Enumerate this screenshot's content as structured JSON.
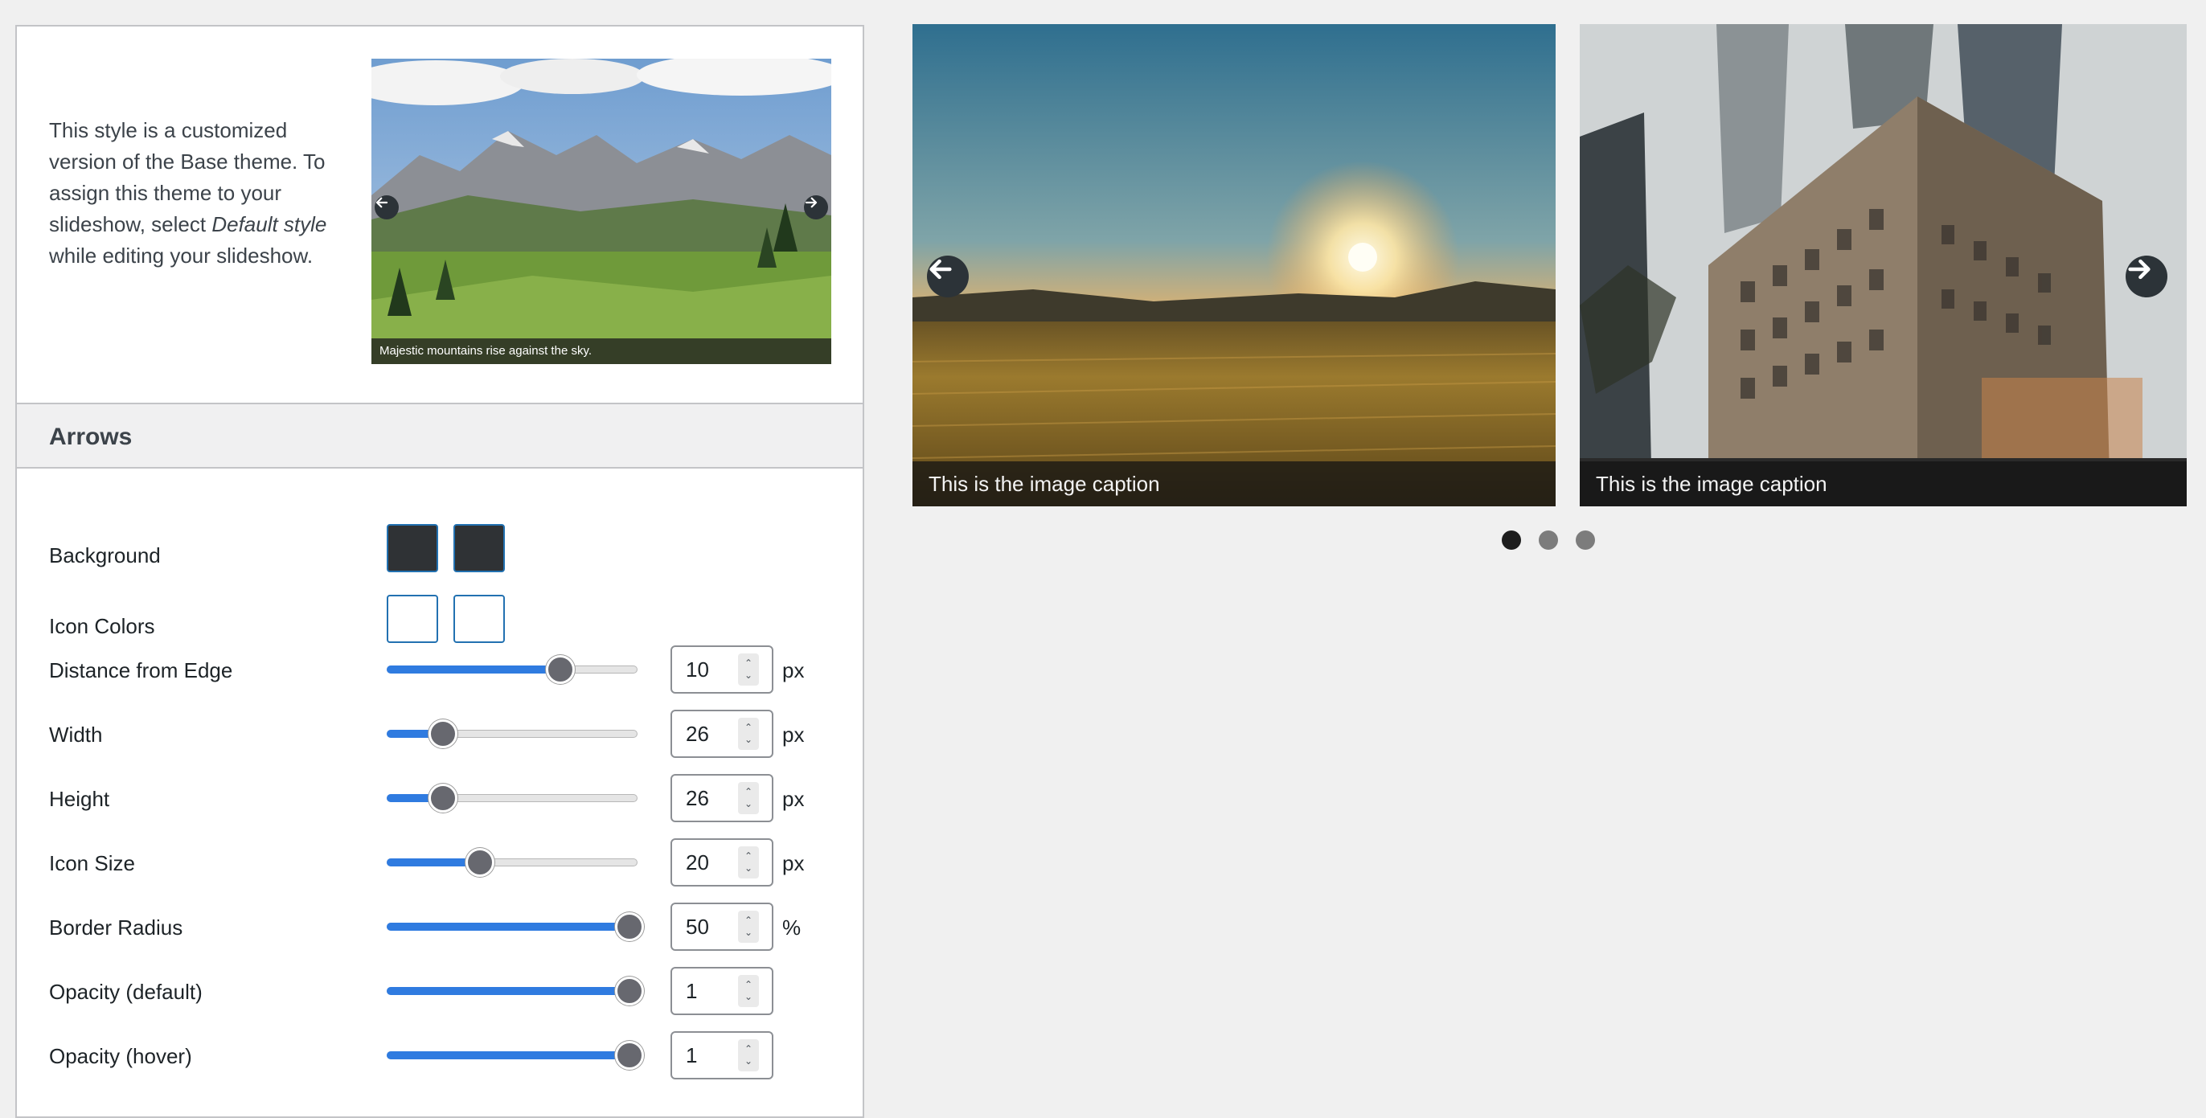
{
  "intro": {
    "text_before": "This style is a customized version of the Base theme. To assign this theme to your slideshow, select ",
    "text_em": "Default style",
    "text_after": " while editing your slideshow.",
    "preview_caption": "Majestic mountains rise against the sky."
  },
  "arrows_section": {
    "title": "Arrows",
    "background": {
      "label": "Background",
      "colors": [
        "#2f3235",
        "#2f3235"
      ]
    },
    "icon_colors": {
      "label": "Icon Colors",
      "colors": [
        "#ffffff",
        "#ffffff"
      ]
    },
    "settings": [
      {
        "label": "Distance from Edge",
        "value": "10",
        "unit": "px",
        "slider_fraction": 0.7
      },
      {
        "label": "Width",
        "value": "26",
        "unit": "px",
        "slider_fraction": 0.19
      },
      {
        "label": "Height",
        "value": "26",
        "unit": "px",
        "slider_fraction": 0.19
      },
      {
        "label": "Icon Size",
        "value": "20",
        "unit": "px",
        "slider_fraction": 0.35
      },
      {
        "label": "Border Radius",
        "value": "50",
        "unit": "%",
        "slider_fraction": 1.0
      },
      {
        "label": "Opacity (default)",
        "value": "1",
        "unit": "",
        "slider_fraction": 1.0
      },
      {
        "label": "Opacity (hover)",
        "value": "1",
        "unit": "",
        "slider_fraction": 1.0
      }
    ]
  },
  "slideshow": {
    "slides": [
      {
        "caption": "This is the image caption",
        "icon": "arrow-left-icon"
      },
      {
        "caption": "This is the image caption",
        "icon": "arrow-right-icon"
      }
    ],
    "dots": {
      "count": 3,
      "active_index": 0
    }
  },
  "colors": {
    "accent": "#2f7be0",
    "thumb": "#67686f",
    "arrow_bg": "#2c3338"
  }
}
